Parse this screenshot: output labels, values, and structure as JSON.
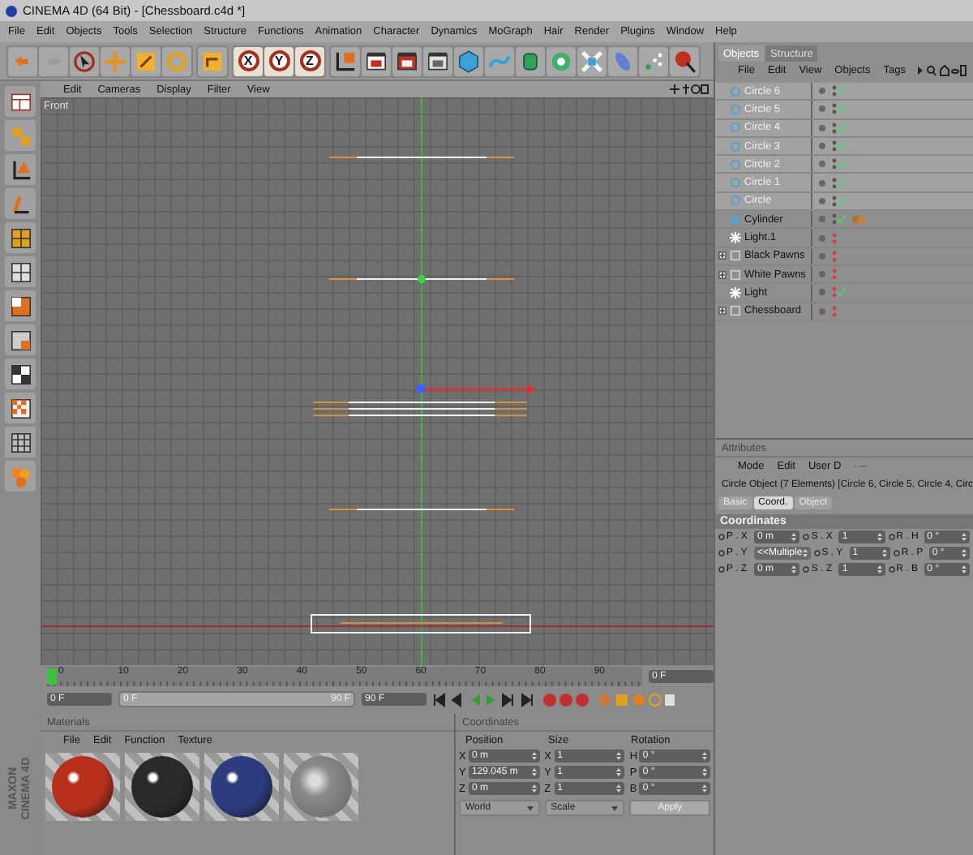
{
  "window": {
    "title": "CINEMA 4D (64 Bit) - [Chessboard.c4d *]"
  },
  "menu": [
    "File",
    "Edit",
    "Objects",
    "Tools",
    "Selection",
    "Structure",
    "Functions",
    "Animation",
    "Character",
    "Dynamics",
    "MoGraph",
    "Hair",
    "Render",
    "Plugins",
    "Window",
    "Help"
  ],
  "toolbar": {
    "axes": [
      {
        "label": "X",
        "on": true
      },
      {
        "label": "Y",
        "on": true
      },
      {
        "label": "Z",
        "on": true
      }
    ]
  },
  "viewport": {
    "menu": [
      "Edit",
      "Cameras",
      "Display",
      "Filter",
      "View"
    ],
    "label": "Front"
  },
  "objects": {
    "tabs": [
      {
        "label": "Objects",
        "selected": true
      },
      {
        "label": "Structure",
        "selected": false
      }
    ],
    "menu": [
      "File",
      "Edit",
      "View",
      "Objects",
      "Tags"
    ],
    "items": [
      {
        "name": "Circle 6",
        "kind": "circle",
        "selected": true,
        "expandable": false,
        "hidden": false,
        "enabled": true,
        "has_tag": false
      },
      {
        "name": "Circle 5",
        "kind": "circle",
        "selected": true,
        "expandable": false,
        "hidden": false,
        "enabled": true,
        "has_tag": false
      },
      {
        "name": "Circle 4",
        "kind": "circle",
        "selected": true,
        "expandable": false,
        "hidden": false,
        "enabled": true,
        "has_tag": false
      },
      {
        "name": "Circle 3",
        "kind": "circle",
        "selected": true,
        "expandable": false,
        "hidden": false,
        "enabled": true,
        "has_tag": false
      },
      {
        "name": "Circle 2",
        "kind": "circle",
        "selected": true,
        "expandable": false,
        "hidden": false,
        "enabled": true,
        "has_tag": false
      },
      {
        "name": "Circle 1",
        "kind": "circle",
        "selected": true,
        "expandable": false,
        "hidden": false,
        "enabled": true,
        "has_tag": false
      },
      {
        "name": "Circle",
        "kind": "circle",
        "selected": true,
        "expandable": false,
        "hidden": false,
        "enabled": true,
        "has_tag": false
      },
      {
        "name": "Cylinder",
        "kind": "cylinder",
        "selected": false,
        "expandable": false,
        "hidden": false,
        "enabled": true,
        "has_tag": true
      },
      {
        "name": "Light.1",
        "kind": "light",
        "selected": false,
        "expandable": false,
        "hidden": true,
        "enabled": false,
        "has_tag": false
      },
      {
        "name": "Black Pawns",
        "kind": "null",
        "selected": false,
        "expandable": true,
        "hidden": true,
        "enabled": false,
        "has_tag": false
      },
      {
        "name": "White Pawns",
        "kind": "null",
        "selected": false,
        "expandable": true,
        "hidden": true,
        "enabled": false,
        "has_tag": false
      },
      {
        "name": "Light",
        "kind": "light",
        "selected": false,
        "expandable": false,
        "hidden": true,
        "enabled": true,
        "has_tag": false
      },
      {
        "name": "Chessboard",
        "kind": "null",
        "selected": false,
        "expandable": true,
        "hidden": true,
        "enabled": false,
        "has_tag": false
      }
    ]
  },
  "attributes": {
    "title": "Attributes",
    "menu": [
      "Mode",
      "Edit",
      "User D"
    ],
    "object": "Circle Object (7 Elements) [Circle 6, Circle 5, Circle 4, Circ",
    "tabs": [
      {
        "label": "Basic",
        "selected": false
      },
      {
        "label": "Coord.",
        "selected": true
      },
      {
        "label": "Object",
        "selected": false
      }
    ],
    "section": "Coordinates",
    "rows": [
      [
        {
          "label": "P . X",
          "value": "0 m"
        },
        {
          "label": "S . X",
          "value": "1"
        },
        {
          "label": "R . H",
          "value": "0 °"
        }
      ],
      [
        {
          "label": "P . Y",
          "value": "<<Multiple"
        },
        {
          "label": "S . Y",
          "value": "1"
        },
        {
          "label": "R . P",
          "value": "0 °"
        }
      ],
      [
        {
          "label": "P . Z",
          "value": "0 m"
        },
        {
          "label": "S . Z",
          "value": "1"
        },
        {
          "label": "R . B",
          "value": "0 °"
        }
      ]
    ]
  },
  "timeline": {
    "ticks": [
      "0",
      "10",
      "20",
      "30",
      "40",
      "50",
      "60",
      "70",
      "80",
      "90"
    ],
    "level": 0,
    "preview_frame": "0 F",
    "current_frame": "0 F",
    "range": {
      "start": "0 F",
      "end": "90 F",
      "level": 1
    },
    "end_frame": "90 F"
  },
  "materials": {
    "title": "Materials",
    "menu": [
      "File",
      "Edit",
      "Function",
      "Texture"
    ],
    "items": [
      {
        "kind": "ball",
        "color": "#b8301c"
      },
      {
        "kind": "ball",
        "color": "#2a2a2a"
      },
      {
        "kind": "ball",
        "color": "#2c3c7c"
      },
      {
        "kind": "glass",
        "color": "#8a8a8a"
      }
    ]
  },
  "coordinates": {
    "title": "Coordinates",
    "columns": [
      "Position",
      "Size",
      "Rotation"
    ],
    "rows": [
      [
        {
          "axis": "X",
          "value": "0 m"
        },
        {
          "axis": "X",
          "value": "1"
        },
        {
          "axis": "H",
          "value": "0 °"
        }
      ],
      [
        {
          "axis": "Y",
          "value": "129.045 m"
        },
        {
          "axis": "Y",
          "value": "1"
        },
        {
          "axis": "P",
          "value": "0 °"
        }
      ],
      [
        {
          "axis": "Z",
          "value": "0 m"
        },
        {
          "axis": "Z",
          "value": "1"
        },
        {
          "axis": "B",
          "value": "0 °"
        }
      ]
    ],
    "dropdowns": [
      "World",
      "Scale"
    ],
    "apply": "Apply"
  },
  "logo": [
    "MAXON",
    "CINEMA 4D"
  ]
}
